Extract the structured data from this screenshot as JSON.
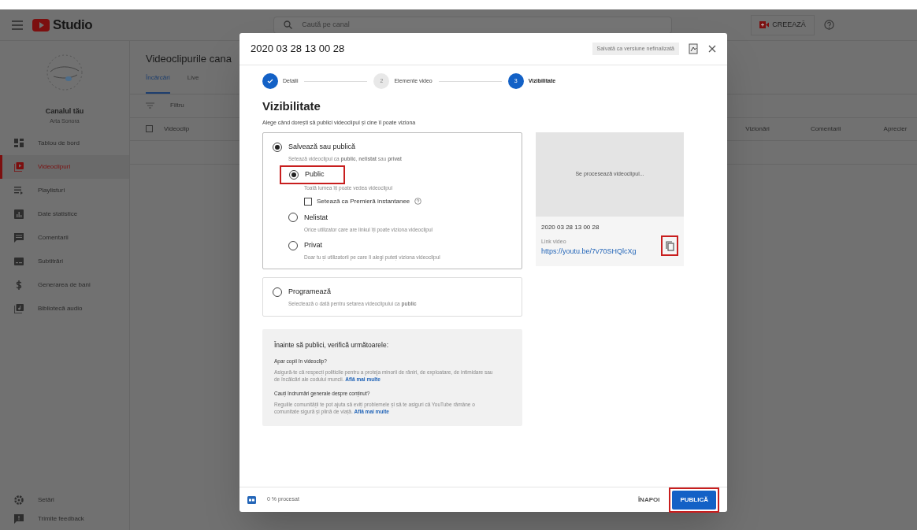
{
  "app": {
    "logo_text": "Studio",
    "search_placeholder": "Caută pe canal",
    "create_label": "CREEAZĂ"
  },
  "sidebar": {
    "channel_label": "Canalul tău",
    "channel_name": "Arta Sonora",
    "items": [
      {
        "label": "Tablou de bord",
        "selected": false
      },
      {
        "label": "Videoclipuri",
        "selected": true
      },
      {
        "label": "Playlisturi",
        "selected": false
      },
      {
        "label": "Date statistice",
        "selected": false
      },
      {
        "label": "Comentarii",
        "selected": false
      },
      {
        "label": "Subtitrări",
        "selected": false
      },
      {
        "label": "Generarea de bani",
        "selected": false
      },
      {
        "label": "Bibliotecă audio",
        "selected": false
      }
    ],
    "footer_items": [
      {
        "label": "Setări"
      },
      {
        "label": "Trimite feedback"
      }
    ]
  },
  "content": {
    "title": "Videoclipurile cana",
    "tabs": [
      {
        "label": "Încărcări",
        "selected": true
      },
      {
        "label": "Live",
        "selected": false
      }
    ],
    "filter_placeholder": "Filtru",
    "select_all": {
      "checked": false
    },
    "columns": [
      "Videoclip",
      "Vizionări",
      "Comentarii",
      "Aprecier"
    ]
  },
  "dialog": {
    "title": "2020 03 28 13 00 28",
    "saved_badge": "Salvată ca versiune nefinalizată",
    "steps": [
      {
        "label": "Detalii",
        "completed": true,
        "selected": false
      },
      {
        "number": "2",
        "label": "Elemente video",
        "completed": false,
        "selected": false
      },
      {
        "number": "3",
        "label": "Vizibilitate",
        "completed": false,
        "selected": true
      }
    ],
    "heading": "Vizibilitate",
    "subtitle": "Alege când dorești să publici videoclipul și cine îl poate viziona",
    "save_option": {
      "label": "Salvează sau publică",
      "selected": true,
      "description": "Setează videoclipul ca **public**, **nelistat** sau **privat**",
      "choices": [
        {
          "label": "Public",
          "selected": true,
          "highlighted": true,
          "description": "Toată lumea îți poate vedea videoclipul",
          "premiere": {
            "label": "Setează ca Premieră instantanee",
            "checked": false
          }
        },
        {
          "label": "Nelistat",
          "selected": false,
          "description": "Orice utilizator care are linkul îți poate viziona videoclipul"
        },
        {
          "label": "Privat",
          "selected": false,
          "description": "Doar tu și utilizatorii pe care îi alegi puteți viziona videoclipul"
        }
      ]
    },
    "schedule_option": {
      "label": "Programează",
      "selected": false,
      "description": "Selectează o dată pentru setarea videoclipului ca **public**"
    },
    "checklist": {
      "heading": "Înainte să publici, verifică următoarele:",
      "sections": [
        {
          "question": "Apar copii în videoclip?",
          "text": "Asigură-te că respecți politicile pentru a proteja minorii de răniri, de exploatare, de intimidare sau de încălcări ale codului muncii.",
          "link": "Află mai multe"
        },
        {
          "question": "Cauți îndrumări generale despre conținut?",
          "text": "Regulile comunității te pot ajuta să eviți problemele și să te asiguri că YouTube rămâne o comunitate sigură și plină de viață.",
          "link": "Află mai multe"
        }
      ]
    },
    "preview": {
      "status": "Se procesează videoclipul...",
      "filename": "2020 03 28 13 00 28",
      "link_label": "Link video",
      "url": "https://youtu.be/7v70SHQlcXg",
      "copy_highlighted": true
    },
    "footer": {
      "progress": "0 % procesat",
      "back_label": "ÎNAPOI",
      "publish_label": "PUBLICĂ",
      "publish_highlighted": true
    }
  }
}
